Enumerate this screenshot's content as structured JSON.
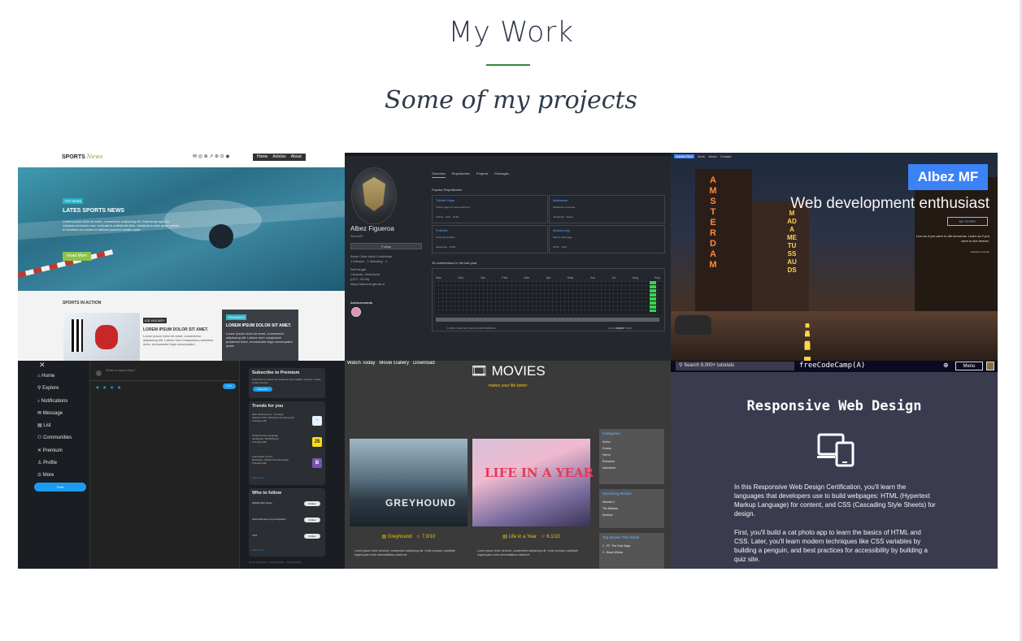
{
  "section": {
    "title": "My Work",
    "subtitle": "Some of my projects"
  },
  "colors": {
    "title_rule": "#2e8b3c",
    "heading": "#2e3a4a"
  },
  "projects": {
    "sports": {
      "logo": "SPORTS",
      "logo_accent": "News",
      "menu": [
        "Home",
        "Articles",
        "About"
      ],
      "hero_tag": "TOP NEWS",
      "hero_headline": "LATES SPORTS NEWS",
      "hero_text": "Lorem ipsum dolor sit amet, consectetur adipiscing elit. Maecenas eget ex volutpat commodo sed, vehicula in sollicitudin felis. Vestibulum ante ipsum primis in faucibus orci luctus et ultrices posuere cubilia curae.",
      "read_more": "Read More",
      "section_heading": "SPORTS IN ACTION",
      "card_tag": "ICE HOCKEY",
      "card_headline": "LOREM IPSUM DOLOR SIT AMET.",
      "card_text": "Lorem ipsum dolor sit amet, consectetur adipiscing elit. Labore eum voluptatum possimus dolor, recusandae fuga consequatur",
      "dark_tag": "SWIMMING",
      "dark_headline": "LOREM IPSUM DOLOR SIT AMET.",
      "dark_text": "Lorem ipsum dolor sit amet, consectetur adipiscing elit. Labore eum voluptatum possimus dolor, recusandae fuga consequatur quam"
    },
    "github": {
      "name": "Albez Figueroa",
      "username": "AlbezMF",
      "follow": "Follow",
      "meta": [
        "Arctic Code Vault Contributor",
        "1 follower · 1 following · 1",
        "Self taught",
        "Caracas, Venezuela",
        "(UTC -04:00)",
        "https://albezmf.github.io"
      ],
      "achievements": "Achievements",
      "tabs": [
        "Overview",
        "Repositories",
        "Projects",
        "Packages"
      ],
      "popular": "Popular Repositories",
      "pins": [
        {
          "name": "Tribute-Page",
          "desc": "Tribute page for freeCodeCamp",
          "lang": "Tribute · CSS · HTML"
        },
        {
          "name": "Markdown",
          "desc": "Markdown previewer",
          "lang": "JavaScript · React"
        },
        {
          "name": "Portfolio",
          "desc": "Personal portfolio",
          "lang": "JavaScript · HTML"
        },
        {
          "name": "Movies-App",
          "desc": "Movies web page",
          "lang": "HTML · CSS"
        }
      ],
      "contrib_title": "94 contributions in the last year",
      "months": [
        "Nov",
        "Dec",
        "Jan",
        "Feb",
        "Mar",
        "Apr",
        "May",
        "Jun",
        "Jul",
        "Aug",
        "Sep"
      ],
      "learn": "Learn how we count contributions",
      "less_more": "Less ■■■■ More"
    },
    "portfolio": {
      "nav": [
        "Zwhite FAO",
        "Work",
        "About",
        "Contact"
      ],
      "name": "Albez MF",
      "tagline": "Web development enthusiast",
      "my_story": "MY STORY",
      "quote": "Live as if you were to die tomorrow. Learn as if you were to live forever.",
      "author": "- Mahatma Gandhi",
      "sign1": "AMSTERDAM",
      "sign2": "MADAME TUSSAUDS"
    },
    "twitter": {
      "nav": [
        "Home",
        "Explore",
        "Notifications",
        "Message",
        "List",
        "Communities",
        "Premium",
        "Profile",
        "More"
      ],
      "post": "Post",
      "compose": "What is happening?!",
      "tweet": "Post",
      "subscribe_title": "Subscribe to Premium",
      "subscribe_text": "Subscribe to unlock new features and if eligible, receive a share of ads revenue.",
      "subscribe_btn": "Subscribe",
      "trends_title": "Trends for you",
      "trends": [
        "Web development · Trending\nTailwind CSS / Windows vs Framework\nTrending with",
        "Programming Language\nJavaScript / ECMAScript\nTrending with",
        "Framework of front\nBootstrap / Mobile-first framework\nTrending with"
      ],
      "trend_icons": [
        "~",
        "JS",
        "B"
      ],
      "show_more": "Show more",
      "follow_title": "Who to follow",
      "follows": [
        "MARM Web Dever",
        "freeCodeCamp.org en Español",
        "YMJ"
      ],
      "follow_btn": "Follow",
      "footer": "Terms of Service · Privacy Policy · Cookie Policy"
    },
    "movies": {
      "nav": [
        "Watch Today",
        "Movie Gallery",
        "Download"
      ],
      "brand": "🎞 MOVIES",
      "slogan": "makes your life better",
      "movie1": "Greyhound",
      "movie1_rating": "☆ 7.0/10",
      "movie2": "Life in a Year",
      "movie2_rating": "☆ 6.1/10",
      "poster1_text": "GREYHOUND",
      "poster2_text": "LIFE IN A YEAR",
      "desc": "Lorem ipsum dolor sit amet, consectetur adipiscing elit. Unde cumque cupiditate fugiat quam nulla necessitatibus deserunt",
      "categories_title": "Categories",
      "categories": [
        "Action",
        "Drama",
        "Horror",
        "Romance",
        "Adventure"
      ],
      "upcoming_title": "Upcoming Movies",
      "upcoming": [
        "Wonder 2",
        "The Batman",
        "Morbius"
      ],
      "top_title": "Top Movies This Week",
      "top": [
        "1 - FF: The Fast Saga",
        "2 - Black Widow"
      ]
    },
    "fcc": {
      "search": "Search 9,000+ tutorials",
      "brand": "freeCodeCamp(A)",
      "menu": "Menu",
      "title": "Responsive Web Design",
      "p1": "In this Responsive Web Design Certification, you'll learn the languages that developers use to build webpages: HTML (Hypertext Markup Language) for content, and CSS (Cascading Style Sheets) for design.",
      "p2": "First, you'll build a cat photo app to learn the basics of HTML and CSS. Later, you'll learn modern techniques like CSS variables by building a penguin, and best practices for accessibility by building a quiz site."
    }
  }
}
